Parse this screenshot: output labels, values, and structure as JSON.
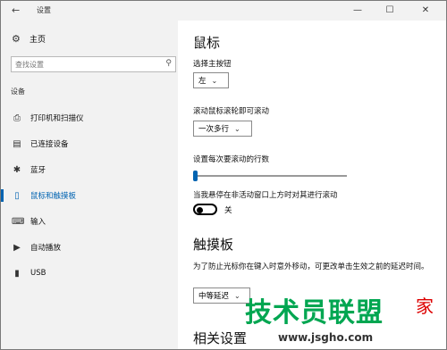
{
  "window": {
    "title": "设置",
    "minimize_icon": "minimize-icon",
    "maximize_icon": "maximize-icon",
    "close_icon": "close-icon"
  },
  "sidebar": {
    "home_label": "主页",
    "search_placeholder": "查找设置",
    "section_label": "设备",
    "items": [
      {
        "label": "打印机和扫描仪",
        "icon": "printer-icon"
      },
      {
        "label": "已连接设备",
        "icon": "connected-devices-icon"
      },
      {
        "label": "蓝牙",
        "icon": "bluetooth-icon"
      },
      {
        "label": "鼠标和触摸板",
        "icon": "mouse-icon",
        "active": true
      },
      {
        "label": "输入",
        "icon": "keyboard-icon"
      },
      {
        "label": "自动播放",
        "icon": "autoplay-icon"
      },
      {
        "label": "USB",
        "icon": "usb-icon"
      }
    ]
  },
  "main": {
    "mouse_heading": "鼠标",
    "primary_button_label": "选择主按钮",
    "primary_button_value": "左",
    "scroll_label": "滚动鼠标滚轮即可滚动",
    "scroll_value": "一次多行",
    "lines_label": "设置每次要滚动的行数",
    "lines_slider_fraction": 0.0,
    "inactive_scroll_label": "当我悬停在非活动窗口上方时对其进行滚动",
    "inactive_scroll_state": "关",
    "touchpad_heading": "触摸板",
    "touchpad_desc": "为了防止光标你在键入时意外移动，可更改单击生效之前的延迟时间。",
    "touchpad_delay_value": "中等延迟",
    "related_heading": "相关设置"
  },
  "watermark": {
    "text": "技术员联盟",
    "suffix": "家",
    "url": "www.jsgho.com"
  },
  "colors": {
    "accent": "#0063b1",
    "sidebar_bg": "#f2f2f2"
  }
}
